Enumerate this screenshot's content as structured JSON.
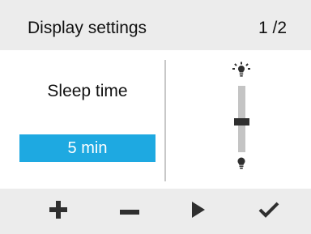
{
  "header": {
    "title": "Display settings",
    "page_indicator": "1 /2"
  },
  "setting": {
    "label": "Sleep time",
    "value": "5 min"
  },
  "brightness_slider": {
    "level": 0.45,
    "max_icon": "bulb-bright-icon",
    "min_icon": "bulb-dim-icon"
  },
  "buttons": {
    "plus": "plus-icon",
    "minus": "minus-icon",
    "next": "play-arrow-icon",
    "confirm": "checkmark-icon"
  },
  "colors": {
    "accent": "#1ea9e1",
    "header_bg": "#ececec",
    "icon": "#2f2f2f",
    "slider_track": "#c4c4c4"
  }
}
